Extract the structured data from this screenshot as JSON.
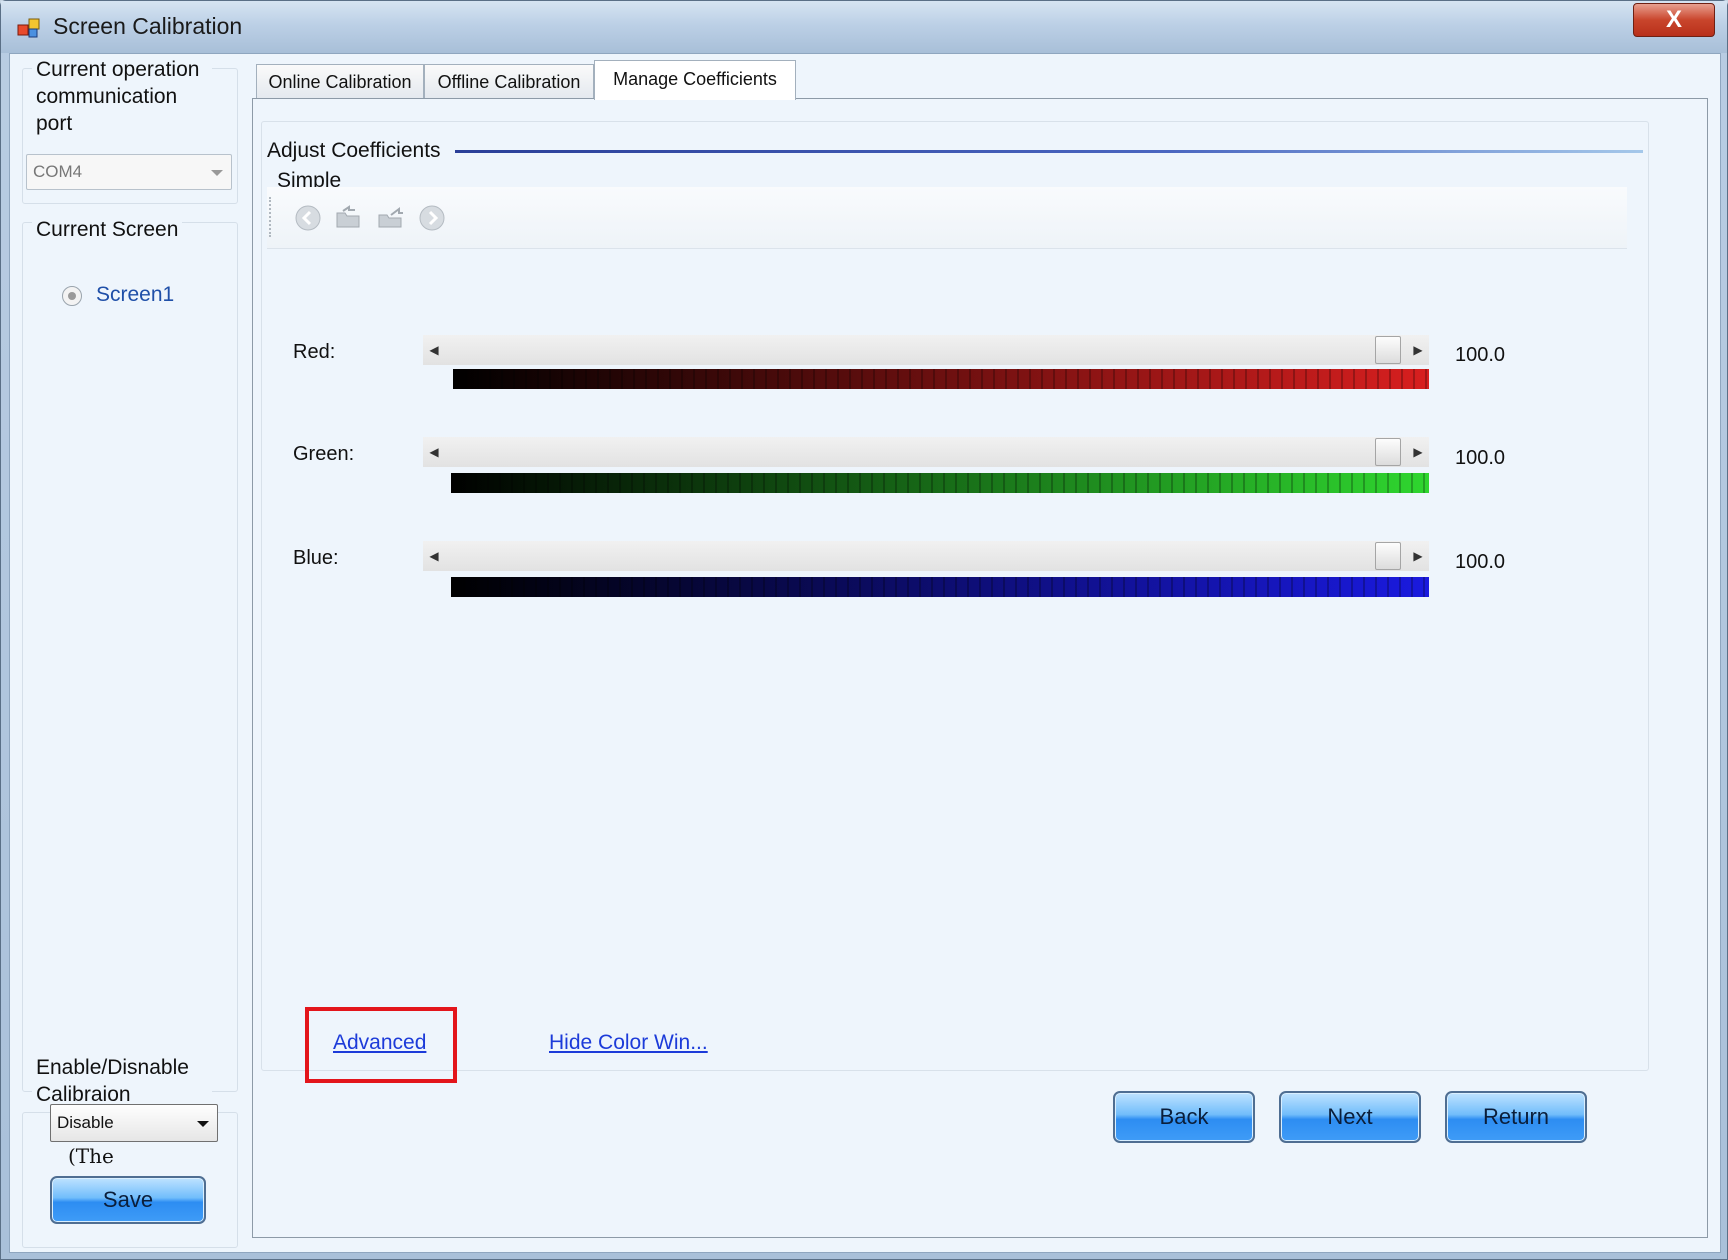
{
  "window": {
    "title": "Screen Calibration",
    "close_label": "X"
  },
  "left": {
    "port_group_title": "Current operation communication port",
    "port_value": "COM4",
    "screen_group_title": "Current Screen",
    "screen_item": "Screen1",
    "calib_group_title": "Enable/Disnable Calibraion",
    "calib_value": "Disable",
    "note_text": "(The",
    "save_label": "Save"
  },
  "tabs": [
    {
      "label": "Online Calibration",
      "active": false
    },
    {
      "label": "Offline Calibration",
      "active": false
    },
    {
      "label": "Manage Coefficients",
      "active": true
    }
  ],
  "panel": {
    "section_title": "Adjust Coefficients",
    "subsection_title": "Simple",
    "toolbar_icons": [
      "back-icon",
      "open-folder-icon",
      "save-folder-icon",
      "forward-icon"
    ],
    "sliders": [
      {
        "label": "Red:",
        "value_text": "100.0",
        "value": 100,
        "color": "#d81f1f"
      },
      {
        "label": "Green:",
        "value_text": "100.0",
        "value": 100,
        "color": "#2fd62f"
      },
      {
        "label": "Blue:",
        "value_text": "100.0",
        "value": 100,
        "color": "#1a1adf"
      }
    ],
    "advanced_link": "Advanced",
    "hide_color_link": "Hide Color Win...",
    "back_label": "Back",
    "next_label": "Next",
    "return_label": "Return"
  }
}
